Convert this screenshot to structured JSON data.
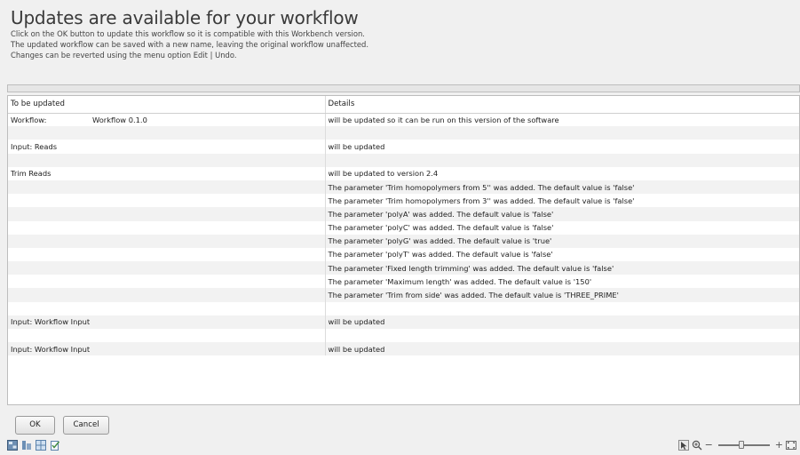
{
  "header": {
    "title": "Updates are available for your workflow",
    "lines": [
      "Click on the OK button to update this workflow so it is compatible with this Workbench version.",
      "The updated workflow can be saved with a new name, leaving the original workflow unaffected.",
      "Changes can be reverted using the menu option Edit | Undo."
    ]
  },
  "table": {
    "columns": [
      "To be updated",
      "Details"
    ],
    "rows": [
      {
        "a": "Workflow:",
        "a2": "Workflow 0.1.0",
        "b": "will be updated so it can be run on this version of the software"
      },
      {
        "a": "",
        "b": ""
      },
      {
        "a": "Input: Reads",
        "b": "will be updated"
      },
      {
        "a": "",
        "b": ""
      },
      {
        "a": "Trim Reads",
        "b": "will be updated to version 2.4"
      },
      {
        "a": "",
        "b": "The parameter 'Trim homopolymers from 5'' was added. The default value is 'false'"
      },
      {
        "a": "",
        "b": "The parameter 'Trim homopolymers from 3'' was added. The default value is 'false'"
      },
      {
        "a": "",
        "b": "The parameter 'polyA' was added. The default value is 'false'"
      },
      {
        "a": "",
        "b": "The parameter 'polyC' was added. The default value is 'false'"
      },
      {
        "a": "",
        "b": "The parameter 'polyG' was added. The default value is 'true'"
      },
      {
        "a": "",
        "b": "The parameter 'polyT' was added. The default value is 'false'"
      },
      {
        "a": "",
        "b": "The parameter 'Fixed length trimming' was added. The default value is 'false'"
      },
      {
        "a": "",
        "b": "The parameter 'Maximum length' was added. The default value is '150'"
      },
      {
        "a": "",
        "b": "The parameter 'Trim from side' was added. The default value is 'THREE_PRIME'"
      },
      {
        "a": "",
        "b": ""
      },
      {
        "a": "Input: Workflow Input",
        "b": "will be updated"
      },
      {
        "a": "",
        "b": ""
      },
      {
        "a": "Input: Workflow Input",
        "b": "will be updated"
      }
    ]
  },
  "buttons": {
    "ok": "OK",
    "cancel": "Cancel"
  },
  "status_icons": [
    "layout-icon",
    "align-icon",
    "grid-icon",
    "check-doc-icon"
  ],
  "zoom": {
    "select_icon": "select-mode-icon",
    "zoom_icon": "zoom-in-icon",
    "minus": "−",
    "plus": "+",
    "fit_icon": "fit-to-window-icon",
    "level": 0.45
  }
}
